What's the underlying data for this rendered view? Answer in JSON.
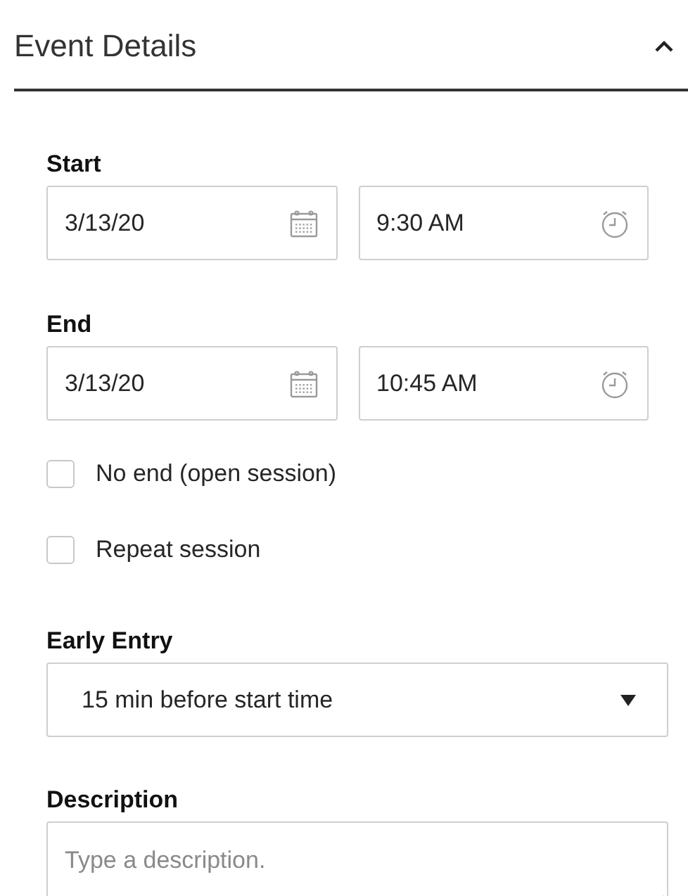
{
  "section": {
    "title": "Event Details",
    "expanded": true
  },
  "start": {
    "label": "Start",
    "date": "3/13/20",
    "time": "9:30 AM"
  },
  "end": {
    "label": "End",
    "date": "3/13/20",
    "time": "10:45 AM"
  },
  "options": [
    {
      "label": "No end (open session)",
      "checked": false
    },
    {
      "label": "Repeat session",
      "checked": false
    }
  ],
  "early_entry": {
    "label": "Early Entry",
    "value": "15 min before start time"
  },
  "description": {
    "label": "Description",
    "placeholder": "Type a description."
  }
}
